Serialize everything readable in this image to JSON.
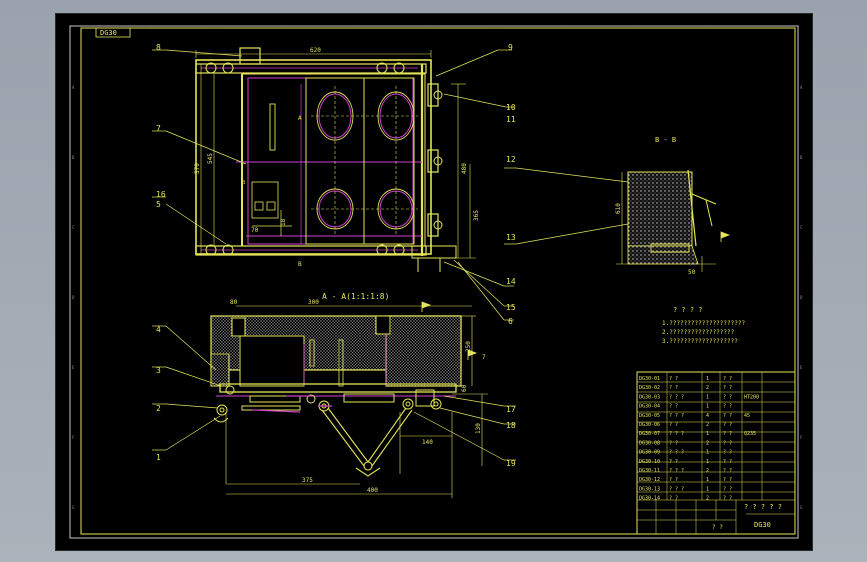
{
  "drawing": {
    "code_box": "DG30",
    "section_title": "A - A(1:1:1:8)",
    "view_label": "B - B",
    "notes_title": "? ? ? ?",
    "notes": [
      "1.?????????????????????",
      "2.??????????????????",
      "3.???????????????????"
    ],
    "sheet_code": "DG30"
  },
  "callouts": [
    "1",
    "2",
    "3",
    "4",
    "5",
    "6",
    "7",
    "8",
    "9",
    "10",
    "11",
    "12",
    "13",
    "14",
    "15",
    "16",
    "17",
    "18",
    "19"
  ],
  "plan_dims": {
    "top_width": "620",
    "right_height": "480",
    "right_lower": "365",
    "left_overall": "570",
    "left_inner": "545",
    "inner_small": "70",
    "inner_val": "18"
  },
  "section_dims": {
    "left_gap": "80",
    "top_width": "300",
    "right_height": "250",
    "right_small": "60",
    "right_140": "140",
    "right_130": "130",
    "bottom_375": "375",
    "bottom_400": "400"
  },
  "bview_dims": {
    "height": "610",
    "bottom": "50"
  },
  "title_block": {
    "rows": [
      [
        "DG30-01",
        "? ?",
        "1",
        "? ?",
        ""
      ],
      [
        "DG30-02",
        "? ?",
        "2",
        "? ?",
        ""
      ],
      [
        "DG30-03",
        "? ? ?",
        "1",
        "? ?",
        "HT200"
      ],
      [
        "DG30-04",
        "? ?",
        "1",
        "? ?",
        ""
      ],
      [
        "DG30-05",
        "? ? ?",
        "4",
        "? ?",
        "45"
      ],
      [
        "DG30-06",
        "? ?",
        "2",
        "? ?",
        ""
      ],
      [
        "DG30-07",
        "? ? ?",
        "1",
        "? ?",
        "Q235"
      ],
      [
        "DG30-08",
        "? ?",
        "2",
        "? ?",
        ""
      ],
      [
        "DG30-09",
        "? ? ?",
        "1",
        "? ?",
        ""
      ],
      [
        "DG30-10",
        "? ?",
        "1",
        "? ?",
        ""
      ],
      [
        "DG30-11",
        "? ? ?",
        "2",
        "? ?",
        ""
      ],
      [
        "DG30-12",
        "? ?",
        "1",
        "? ?",
        ""
      ],
      [
        "DG30-13",
        "? ? ?",
        "1",
        "? ?",
        ""
      ],
      [
        "DG30-14",
        "? ?",
        "2",
        "? ?",
        ""
      ]
    ],
    "product": "? ? ? ? ?",
    "signature": "? ?"
  }
}
